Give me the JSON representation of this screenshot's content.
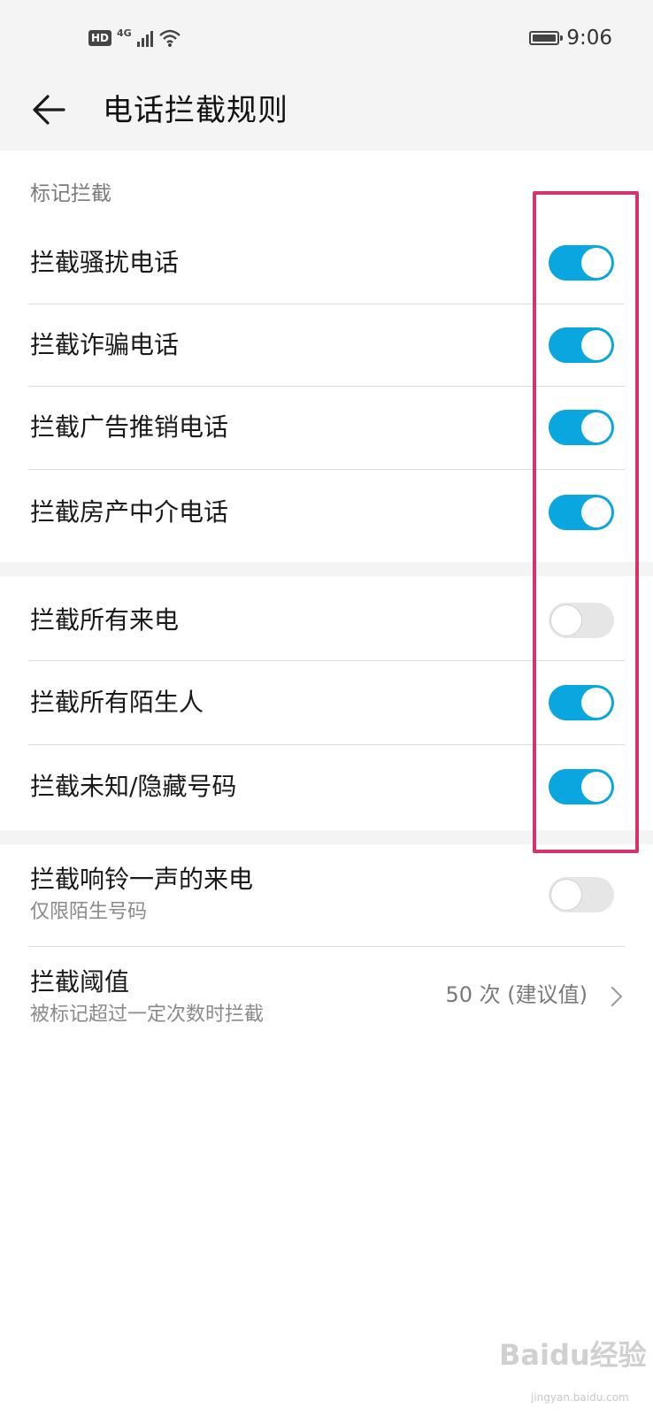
{
  "status": {
    "hd": "HD",
    "network": "4G",
    "time": "9:06"
  },
  "header": {
    "title": "电话拦截规则"
  },
  "sections": {
    "marked_label": "标记拦截"
  },
  "rules": [
    {
      "label": "拦截骚扰电话",
      "on": true
    },
    {
      "label": "拦截诈骗电话",
      "on": true
    },
    {
      "label": "拦截广告推销电话",
      "on": true
    },
    {
      "label": "拦截房产中介电话",
      "on": true
    },
    {
      "label": "拦截所有来电",
      "on": false
    },
    {
      "label": "拦截所有陌生人",
      "on": true
    },
    {
      "label": "拦截未知/隐藏号码",
      "on": true
    },
    {
      "label": "拦截响铃一声的来电",
      "sub": "仅限陌生号码",
      "on": false
    }
  ],
  "threshold": {
    "label": "拦截阈值",
    "sub": "被标记超过一定次数时拦截",
    "value": "50 次 (建议值)"
  },
  "watermark": {
    "text": "Baidu经验",
    "sub": "jingyan.baidu.com"
  },
  "colors": {
    "toggle_on": "#09a6e0",
    "toggle_off": "#e6e6e6",
    "highlight": "#d5336f"
  }
}
